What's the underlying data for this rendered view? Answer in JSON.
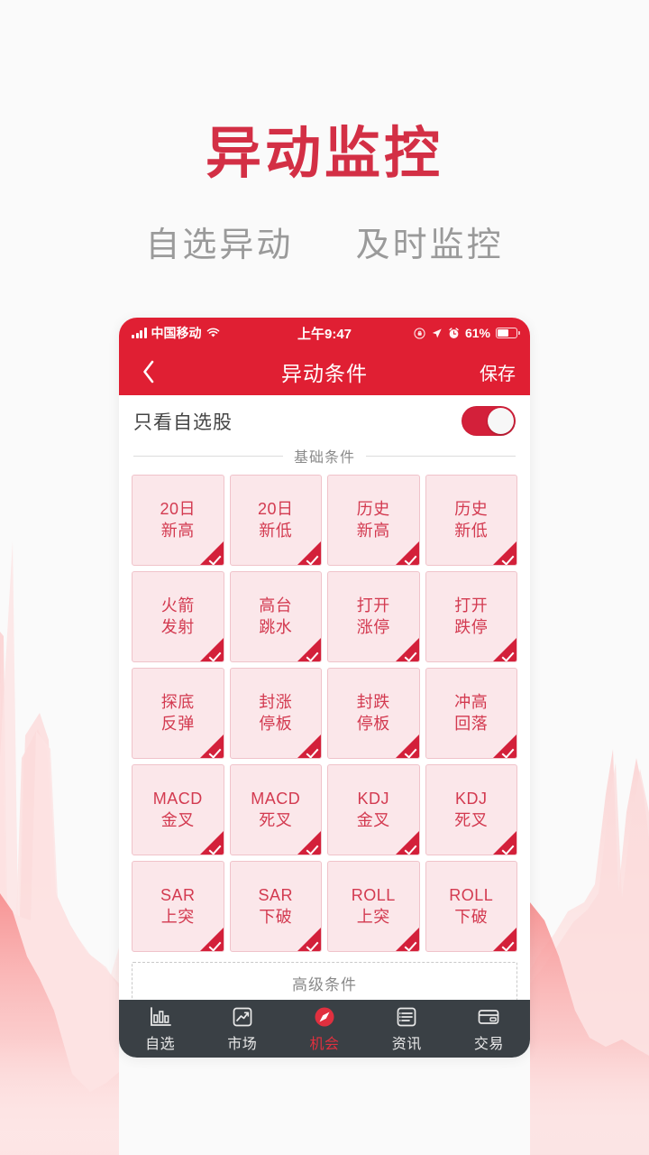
{
  "promo": {
    "title": "异动监控",
    "subtitle_left": "自选异动",
    "subtitle_right": "及时监控",
    "title_color": "#d32f45",
    "subtitle_color": "#9a9a9a",
    "background_color": "#fafafa"
  },
  "status_bar": {
    "carrier": "中国移动",
    "time": "上午9:47",
    "battery_percent": "61%",
    "icons": [
      "signal-icon",
      "wifi-icon",
      "rotation-lock-icon",
      "location-arrow-icon",
      "alarm-clock-icon",
      "battery-icon"
    ],
    "background_color": "#e01f33"
  },
  "nav_bar": {
    "back_label": "‹",
    "title": "异动条件",
    "save_label": "保存",
    "background_color": "#e01f33"
  },
  "options": {
    "watchlist_only_label": "只看自选股",
    "watchlist_only_on": true,
    "switch_color": "#d3203a"
  },
  "basic_section": {
    "title": "基础条件",
    "card_bg": "#fbe7ea",
    "card_border": "#f0c3ca",
    "card_text_color": "#d33a50",
    "check_color": "#d3203a",
    "cards": [
      {
        "line1": "20日",
        "line2": "新高",
        "selected": true
      },
      {
        "line1": "20日",
        "line2": "新低",
        "selected": true
      },
      {
        "line1": "历史",
        "line2": "新高",
        "selected": true
      },
      {
        "line1": "历史",
        "line2": "新低",
        "selected": true
      },
      {
        "line1": "火箭",
        "line2": "发射",
        "selected": true
      },
      {
        "line1": "高台",
        "line2": "跳水",
        "selected": true
      },
      {
        "line1": "打开",
        "line2": "涨停",
        "selected": true
      },
      {
        "line1": "打开",
        "line2": "跌停",
        "selected": true
      },
      {
        "line1": "探底",
        "line2": "反弹",
        "selected": true
      },
      {
        "line1": "封涨",
        "line2": "停板",
        "selected": true
      },
      {
        "line1": "封跌",
        "line2": "停板",
        "selected": true
      },
      {
        "line1": "冲高",
        "line2": "回落",
        "selected": true
      },
      {
        "line1": "MACD",
        "line2": "金叉",
        "selected": true
      },
      {
        "line1": "MACD",
        "line2": "死叉",
        "selected": true
      },
      {
        "line1": "KDJ",
        "line2": "金叉",
        "selected": true
      },
      {
        "line1": "KDJ",
        "line2": "死叉",
        "selected": true
      },
      {
        "line1": "SAR",
        "line2": "上突",
        "selected": true
      },
      {
        "line1": "SAR",
        "line2": "下破",
        "selected": true
      },
      {
        "line1": "ROLL",
        "line2": "上突",
        "selected": true
      },
      {
        "line1": "ROLL",
        "line2": "下破",
        "selected": true
      }
    ]
  },
  "advanced_section": {
    "title": "高级条件",
    "placeholder_count": 4
  },
  "tab_bar": {
    "background_color": "#3a4045",
    "active_color": "#e0303f",
    "items": [
      {
        "label": "自选",
        "icon": "bar-chart-icon",
        "active": false
      },
      {
        "label": "市场",
        "icon": "trend-up-icon",
        "active": false
      },
      {
        "label": "机会",
        "icon": "compass-icon",
        "active": true
      },
      {
        "label": "资讯",
        "icon": "list-icon",
        "active": false
      },
      {
        "label": "交易",
        "icon": "card-icon",
        "active": false
      }
    ]
  }
}
